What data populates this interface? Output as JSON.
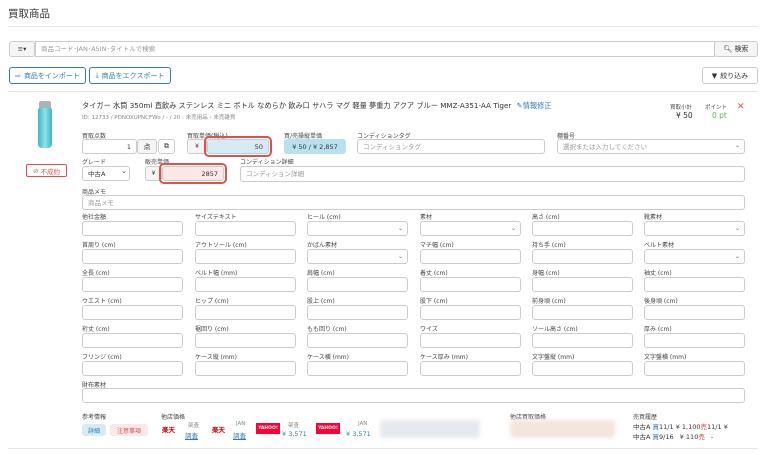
{
  "page_title": "買取商品",
  "search": {
    "filter_label": "≡▾",
    "placeholder": "商品コード･JAN･ASIN･タイトルで検索",
    "button": "検索"
  },
  "toolbar": {
    "import": "商品をインポート",
    "export": "商品をエクスポート",
    "filter": "絞り込み"
  },
  "product": {
    "title": "タイガー 水筒 350ml 直飲み ステンレス ミニ ボトル なめらか 飲み口 サハラ マグ 軽量 夢重力 アクア ブルー MMZ-A351-AA Tiger",
    "edit_link": "情報修正",
    "meta": "ID: 12733 / PDNOXUPNCFWo / - / 20 : 未売用品 › 未売雑貨",
    "subtotal_label": "買取小計",
    "subtotal_value": "¥ 50",
    "points_label": "ポイント",
    "points_value": "0 pt",
    "status_badge": "不成約",
    "quantity_label": "買取点数",
    "quantity_value": "1",
    "quantity_unit": "点",
    "buy_price_label": "買取単価(税込)",
    "yen": "¥",
    "buy_price_value": "50",
    "buy_sell_label": "買/売操縦単価",
    "buy_sell_value": "¥ 50 / ¥ 2,857",
    "condition_tag_label": "コンディションタグ",
    "condition_tag_placeholder": "コンディションタグ",
    "storage_label": "棚番号",
    "storage_placeholder": "選択または入力してください",
    "grade_label": "グレード",
    "grade_value": "中古A",
    "sell_price_label": "販売単価",
    "sell_price_value": "2857",
    "condition_detail_label": "コンディション詳細",
    "condition_detail_placeholder": "コンディション詳細",
    "memo_label": "商品メモ",
    "memo_placeholder": "商品メモ"
  },
  "attributes": [
    [
      "他社金額",
      "サイズテキスト",
      "ヒール (cm)",
      "素材",
      "高さ (cm)",
      "靴素材"
    ],
    [
      "首周り (cm)",
      "アウトソール (cm)",
      "かばん素材",
      "マチ幅 (cm)",
      "持ち手 (cm)",
      "ベルト素材"
    ],
    [
      "全長 (cm)",
      "ベルト幅 (mm)",
      "肩幅 (cm)",
      "着丈 (cm)",
      "身幅 (cm)",
      "袖丈 (cm)"
    ],
    [
      "ウエスト (cm)",
      "ヒップ (cm)",
      "股上 (cm)",
      "股下 (cm)",
      "前身頃 (cm)",
      "後身頃 (cm)"
    ],
    [
      "裄丈 (cm)",
      "裾回り (cm)",
      "もも回り (cm)",
      "ワイズ",
      "ソール高さ (cm)",
      "厚み (cm)"
    ],
    [
      "フリンジ (cm)",
      "ケース縦 (mm)",
      "ケース横 (mm)",
      "ケース厚み (mm)",
      "文字盤縦 (mm)",
      "文字盤横 (mm)"
    ]
  ],
  "wallet_material_label": "財布素材",
  "reference": {
    "label": "参考情報",
    "detail_button": "詳細",
    "caution_button": "注意事項",
    "other_price_label": "他店価格",
    "rakuten_logo": "楽天",
    "rakuten_note": "架査",
    "rakuten_price": "調査",
    "rakuten2_logo": "楽天",
    "rakuten2_note": "JAN",
    "rakuten2_price": "調査",
    "yahoo_logo": "YAHOO!",
    "yahoo_note": "架査",
    "yahoo_price": "¥ 3,571",
    "yahoo2_logo": "YAHOO!",
    "yahoo2_note": "JAN",
    "yahoo2_price": "¥ 3,571",
    "other_buy_label": "他店買取価格",
    "history_label": "売買履歴",
    "history_rows": [
      {
        "grade": "中古A",
        "type": "買",
        "date": "11/1",
        "price": "¥ 1,100",
        "type2": "売",
        "date2": "11/1",
        "price2": "¥"
      },
      {
        "grade": "中古A",
        "type": "買",
        "date": "9/16",
        "price": "¥ 110",
        "type2": "売",
        "date2": "",
        "price2": "-"
      }
    ]
  },
  "colors": {
    "accent": "#337ab7",
    "danger": "#d9534f",
    "green": "#5cb85c",
    "highlight": "#d6ebf5"
  }
}
